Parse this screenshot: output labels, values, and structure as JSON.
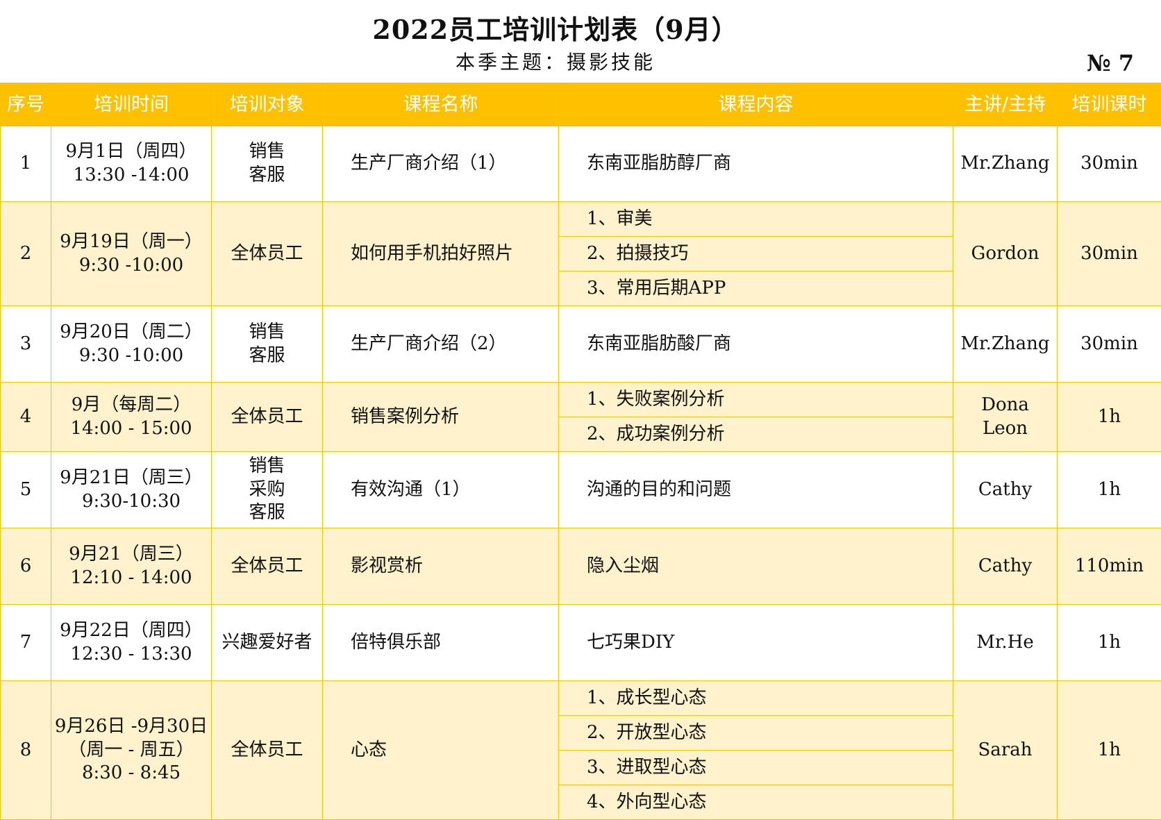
{
  "header": {
    "title": "2022员工培训计划表（9月）",
    "subtitle": "本季主题：摄影技能",
    "doc_no": "№ 7"
  },
  "columns": [
    "序号",
    "培训时间",
    "培训对象",
    "课程名称",
    "课程内容",
    "主讲/主持",
    "培训课时"
  ],
  "rows": [
    {
      "no": "1",
      "time": "9月1日（周四）\n13:30 -14:00",
      "target": "销售\n客服",
      "course": "生产厂商介绍（1）",
      "content": [
        "东南亚脂肪醇厂商"
      ],
      "host": "Mr.Zhang",
      "hours": "30min"
    },
    {
      "no": "2",
      "time": "9月19日（周一）\n9:30 -10:00",
      "target": "全体员工",
      "course": "如何用手机拍好照片",
      "content": [
        "1、审美",
        "2、拍摄技巧",
        "3、常用后期APP"
      ],
      "host": "Gordon",
      "hours": "30min"
    },
    {
      "no": "3",
      "time": "9月20日（周二）\n9:30 -10:00",
      "target": "销售\n客服",
      "course": "生产厂商介绍（2）",
      "content": [
        "东南亚脂肪酸厂商"
      ],
      "host": "Mr.Zhang",
      "hours": "30min"
    },
    {
      "no": "4",
      "time": "9月（每周二）\n14:00 - 15:00",
      "target": "全体员工",
      "course": "销售案例分析",
      "content": [
        "1、失败案例分析",
        "2、成功案例分析"
      ],
      "host": "Dona\nLeon",
      "hours": "1h"
    },
    {
      "no": "5",
      "time": "9月21日（周三）\n9:30-10:30",
      "target": "销售\n采购\n客服",
      "course": "有效沟通（1）",
      "content": [
        "沟通的目的和问题"
      ],
      "host": "Cathy",
      "hours": "1h"
    },
    {
      "no": "6",
      "time": "9月21（周三）\n12:10 - 14:00",
      "target": "全体员工",
      "course": "影视赏析",
      "content": [
        "隐入尘烟"
      ],
      "host": "Cathy",
      "hours": "110min"
    },
    {
      "no": "7",
      "time": "9月22日（周四）\n12:30 - 13:30",
      "target": "兴趣爱好者",
      "course": "倍特俱乐部",
      "content": [
        "七巧果DIY"
      ],
      "host": "Mr.He",
      "hours": "1h"
    },
    {
      "no": "8",
      "time": "9月26日 -9月30日\n（周一 - 周五）\n8:30 - 8:45",
      "target": "全体员工",
      "course": "心态",
      "content": [
        "1、成长型心态",
        "2、开放型心态",
        "3、进取型心态",
        "4、外向型心态"
      ],
      "host": "Sarah",
      "hours": "1h"
    }
  ]
}
